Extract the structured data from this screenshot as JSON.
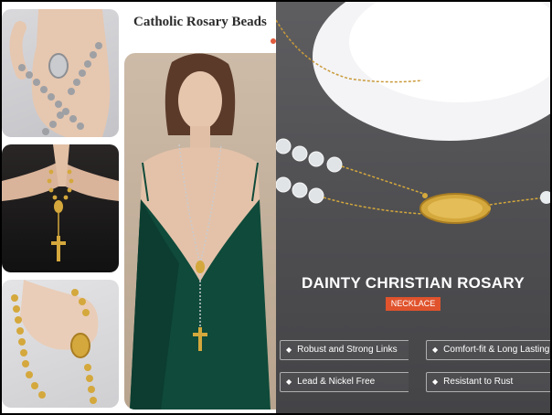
{
  "left_panel": {
    "title": "Catholic Rosary Beads"
  },
  "right_panel": {
    "heading": "DAINTY CHRISTIAN ROSARY",
    "badge": "NECKLACE",
    "features": [
      "Robust and Strong Links",
      "Comfort-fit & Long Lasting",
      "Lead & Nickel Free",
      "Resistant to Rust"
    ]
  },
  "colors": {
    "accent": "#e0532d",
    "panel_bg": "#58585b",
    "gold": "#d4a83c",
    "silver": "#b7b8bc"
  },
  "icons": [
    "diamond-bullet-icon"
  ]
}
